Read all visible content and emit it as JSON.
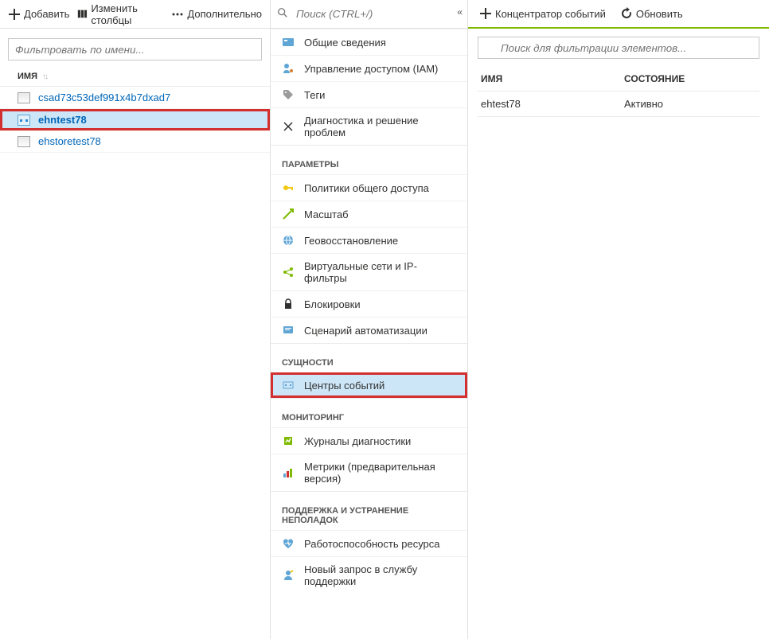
{
  "left": {
    "toolbar": {
      "add": "Добавить",
      "editColumns": "Изменить столбцы",
      "more": "Дополнительно"
    },
    "filterPlaceholder": "Фильтровать по имени...",
    "columnHeader": "ИМЯ",
    "items": [
      {
        "label": "csad73c53def991x4b7dxad7",
        "type": "storage"
      },
      {
        "label": "ehntest78",
        "type": "eventhub",
        "selected": true
      },
      {
        "label": "ehstoretest78",
        "type": "storage"
      }
    ]
  },
  "mid": {
    "searchPlaceholder": "Поиск (CTRL+/)",
    "sections": [
      {
        "header": null,
        "items": [
          {
            "label": "Общие сведения",
            "icon": "overview"
          },
          {
            "label": "Управление доступом (IAM)",
            "icon": "iam"
          },
          {
            "label": "Теги",
            "icon": "tags"
          },
          {
            "label": "Диагностика и решение проблем",
            "icon": "diagnose"
          }
        ]
      },
      {
        "header": "ПАРАМЕТРЫ",
        "items": [
          {
            "label": "Политики общего доступа",
            "icon": "key"
          },
          {
            "label": "Масштаб",
            "icon": "scale"
          },
          {
            "label": "Геовосстановление",
            "icon": "geo"
          },
          {
            "label": "Виртуальные сети и IP-фильтры",
            "icon": "vnet"
          },
          {
            "label": "Блокировки",
            "icon": "lock"
          },
          {
            "label": "Сценарий автоматизации",
            "icon": "automation"
          }
        ]
      },
      {
        "header": "СУЩНОСТИ",
        "items": [
          {
            "label": "Центры событий",
            "icon": "eventhub",
            "selected": true
          }
        ]
      },
      {
        "header": "МОНИТОРИНГ",
        "items": [
          {
            "label": "Журналы диагностики",
            "icon": "diaglogs"
          },
          {
            "label": "Метрики (предварительная версия)",
            "icon": "metrics"
          }
        ]
      },
      {
        "header": "ПОДДЕРЖКА И УСТРАНЕНИЕ НЕПОЛАДОК",
        "items": [
          {
            "label": "Работоспособность ресурса",
            "icon": "health"
          },
          {
            "label": "Новый запрос в службу поддержки",
            "icon": "support"
          }
        ]
      }
    ]
  },
  "right": {
    "toolbar": {
      "hub": "Концентратор событий",
      "refresh": "Обновить"
    },
    "searchPlaceholder": "Поиск для фильтрации элементов...",
    "headers": {
      "name": "ИМЯ",
      "status": "СОСТОЯНИЕ"
    },
    "rows": [
      {
        "name": "ehtest78",
        "status": "Активно"
      }
    ]
  }
}
